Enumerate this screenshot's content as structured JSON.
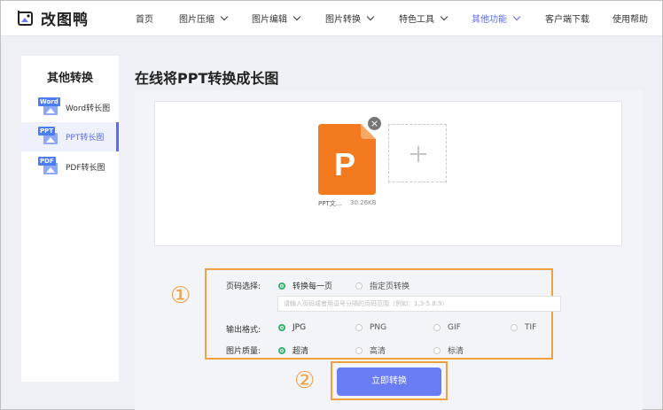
{
  "header": {
    "logo_text": "改图鸭",
    "nav": [
      {
        "label": "首页"
      },
      {
        "label": "图片压缩"
      },
      {
        "label": "图片编辑"
      },
      {
        "label": "图片转换"
      },
      {
        "label": "特色工具"
      },
      {
        "label": "其他功能"
      },
      {
        "label": "客户端下载"
      },
      {
        "label": "使用帮助"
      }
    ],
    "accent_color": "#5b6cf0"
  },
  "sidebar": {
    "title": "其他转换",
    "items": [
      {
        "badge": "Word",
        "label": "Word转长图",
        "icon": "word-file-icon"
      },
      {
        "badge": "PPT",
        "label": "PPT转长图",
        "icon": "ppt-file-icon"
      },
      {
        "badge": "PDF",
        "label": "PDF转长图",
        "icon": "pdf-file-icon"
      }
    ]
  },
  "main": {
    "title": "在线将PPT转换成长图",
    "file": {
      "name": "PPT文...",
      "size": "30.26KB",
      "icon_letter": "P",
      "icon_color": "#f47a20"
    }
  },
  "options": {
    "page_label": "页码选择:",
    "page_all": "转换每一页",
    "page_specific": "指定页转换",
    "page_placeholder": "请输入页码或者用逗号分隔的页码范围（例如：1,3-5,8,9）",
    "format_label": "输出格式:",
    "formats": [
      "JPG",
      "PNG",
      "GIF",
      "TIF"
    ],
    "quality_label": "图片质量:",
    "qualities": [
      "超清",
      "高清",
      "标清"
    ],
    "check_color": "#2fb36a"
  },
  "annotations": {
    "one": "①",
    "two": "②",
    "color": "#f0a040"
  },
  "convert_button": "立即转换"
}
